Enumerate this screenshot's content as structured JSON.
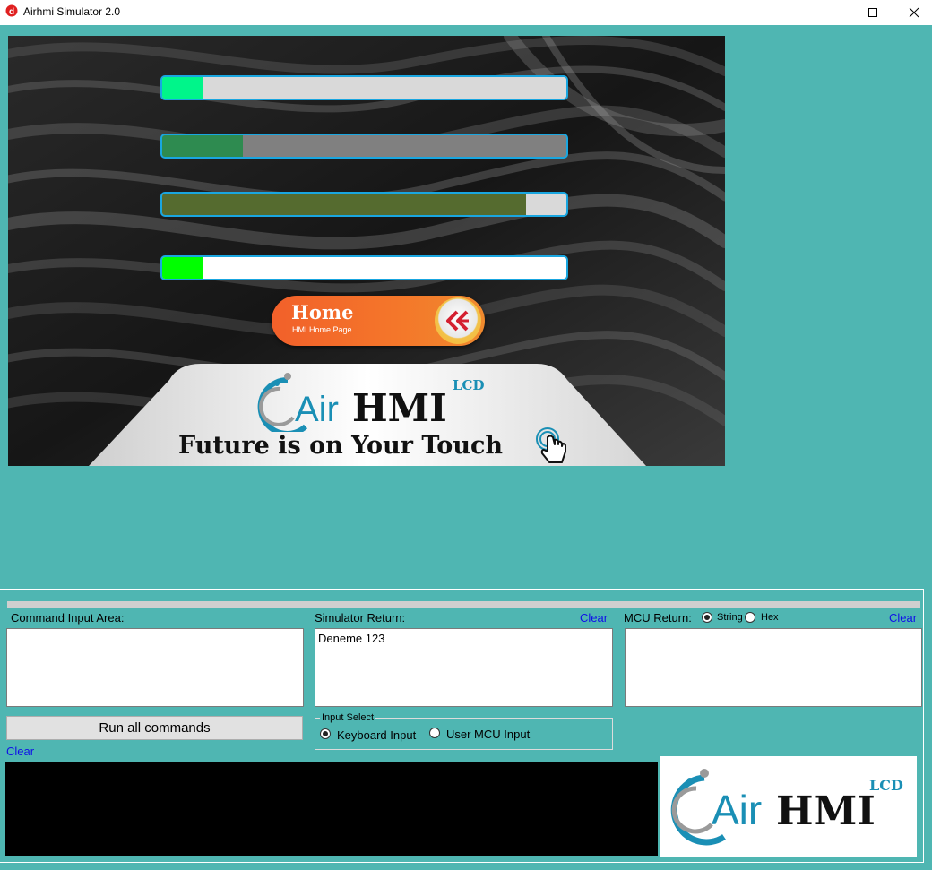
{
  "window": {
    "title": "Airhmi Simulator 2.0",
    "app_icon": "airhmi-d-icon",
    "controls": [
      "minimize-icon",
      "maximize-icon",
      "close-icon"
    ]
  },
  "hmi": {
    "progress_bars": [
      {
        "fill_fraction": 0.1,
        "fill_color": "#00f58a",
        "track_color": "#d9d9d9"
      },
      {
        "fill_fraction": 0.2,
        "fill_color": "#2e8b50",
        "track_color": "#808080"
      },
      {
        "fill_fraction": 0.9,
        "fill_color": "#556b2f",
        "track_color": "#d9d9d9"
      },
      {
        "fill_fraction": 0.1,
        "fill_color": "#00ff00",
        "track_color": "#ffffff"
      }
    ],
    "home_button": {
      "title": "Home",
      "subtitle": "HMI Home Page",
      "icon": "double-chevron-left-icon"
    },
    "logo": {
      "air": "Air",
      "hmi": "HMI",
      "lcd": "LCD"
    },
    "tagline": "Future is on Your Touch",
    "touch_icon": "touch-hand-icon"
  },
  "panel": {
    "command_input": {
      "label": "Command Input Area:",
      "value": ""
    },
    "simulator_return": {
      "label": "Simulator Return:",
      "clear": "Clear",
      "value": "Deneme 123"
    },
    "mcu_return": {
      "label": "MCU Return:",
      "clear": "Clear",
      "value": "",
      "format_options": [
        {
          "label": "String",
          "checked": true
        },
        {
          "label": "Hex",
          "checked": false
        }
      ]
    },
    "run_button": "Run all commands",
    "command_clear": "Clear",
    "input_select": {
      "title": "Input Select",
      "options": [
        {
          "label": "Keyboard Input",
          "checked": true
        },
        {
          "label": "User MCU Input",
          "checked": false
        }
      ]
    },
    "logo": {
      "air": "Air",
      "hmi": "HMI",
      "lcd": "LCD"
    }
  },
  "colors": {
    "background": "#4fb6b2",
    "link": "#1010e8",
    "bar_border": "#19a6e0",
    "home_button": "#f4772a",
    "logo_blue": "#1a8fb5"
  }
}
